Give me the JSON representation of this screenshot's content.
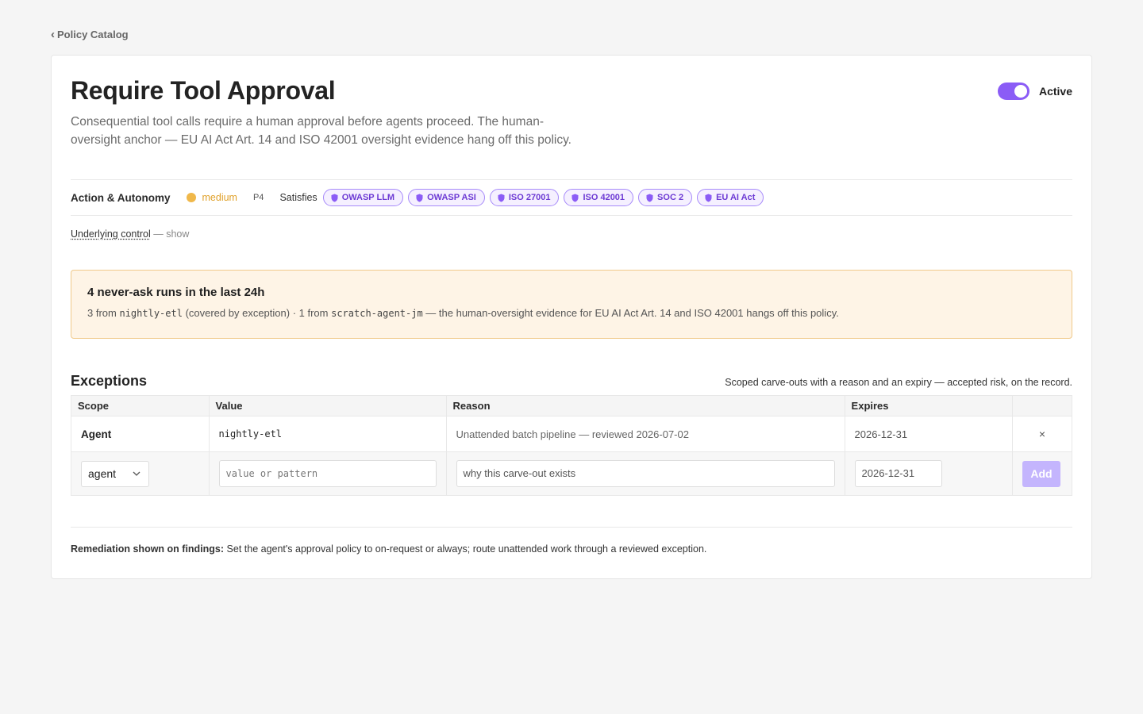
{
  "nav": {
    "back_chevron": "‹",
    "back_label": "Policy Catalog"
  },
  "policy": {
    "title": "Require Tool Approval",
    "description": "Consequential tool calls require a human approval before agents proceed. The human-oversight anchor — EU AI Act Art. 14 and ISO 42001 oversight evidence hang off this policy.",
    "status_label": "Active",
    "status_on": true,
    "accent_color": "#8b5cf6"
  },
  "meta": {
    "category": "Action & Autonomy",
    "severity": "medium",
    "severity_color": "#f0b84a",
    "priority": "P4",
    "satisfies_label": "Satisfies",
    "frameworks": [
      "OWASP LLM",
      "OWASP ASI",
      "ISO 27001",
      "ISO 42001",
      "SOC 2",
      "EU AI Act"
    ]
  },
  "underlying": {
    "link": "Underlying control",
    "suffix": " — show"
  },
  "alert": {
    "title": "4 never-ask runs in the last 24h",
    "p1": "3 from ",
    "agent1": "nightly-etl",
    "p2": " (covered by exception) · 1 from ",
    "agent2": "scratch-agent-jm",
    "p3": " — the human-oversight evidence for EU AI Act Art. 14 and ISO 42001 hangs off this policy.",
    "bg_color": "#fef4e6"
  },
  "exceptions": {
    "title": "Exceptions",
    "note": "Scoped carve-outs with a reason and an expiry — accepted risk, on the record.",
    "columns": {
      "scope": "Scope",
      "value": "Value",
      "reason": "Reason",
      "expires": "Expires"
    },
    "rows": [
      {
        "scope": "Agent",
        "value": "nightly-etl",
        "reason": "Unattended batch pipeline — reviewed 2026-07-02",
        "expires": "2026-12-31",
        "delete": "×"
      }
    ],
    "form": {
      "scope_selected": "agent",
      "value_placeholder": "value or pattern",
      "reason_placeholder": "why this carve-out exists",
      "expires_value": "2026-12-31",
      "add_label": "Add"
    }
  },
  "remediation": {
    "label": "Remediation shown on findings:",
    "text": " Set the agent's approval policy to on-request or always; route unattended work through a reviewed exception."
  }
}
